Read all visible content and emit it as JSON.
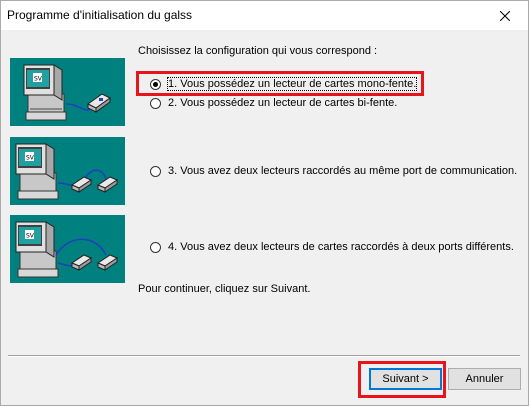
{
  "window": {
    "title": "Programme d'initialisation du galss",
    "close_icon": "close-icon"
  },
  "main": {
    "intro": "Choisissez la configuration qui vous correspond :",
    "options": [
      {
        "label": "1. Vous possédez un lecteur de cartes mono-fente.",
        "selected": true,
        "highlighted": true
      },
      {
        "label": "2. Vous possédez un lecteur de cartes bi-fente.",
        "selected": false
      },
      {
        "label": "3. Vous avez deux lecteurs raccordés au même port de communication.",
        "selected": false
      },
      {
        "label": "4. Vous avez deux lecteurs de cartes raccordés à deux ports différents.",
        "selected": false
      }
    ],
    "continue_text": "Pour continuer, cliquez sur Suivant."
  },
  "buttons": {
    "next_label": "Suivant >",
    "cancel_label": "Annuler"
  },
  "colors": {
    "illustration_bg": "#00807f",
    "highlight": "#e8141c",
    "cable": "#1f3fbf"
  }
}
